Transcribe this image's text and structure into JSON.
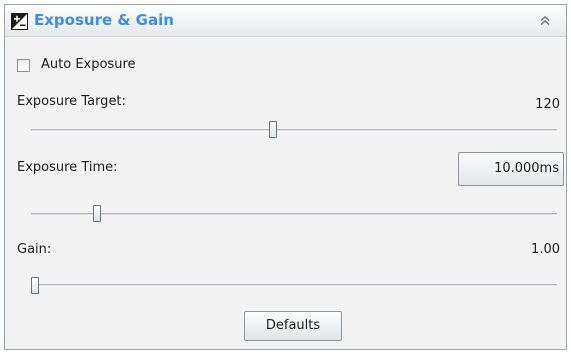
{
  "panel": {
    "title": "Exposure & Gain",
    "title_icon": "exposure-icon",
    "collapse_icon": "double-chevron-up-icon",
    "accent_color": "#3d8ee6"
  },
  "auto_exposure": {
    "label": "Auto Exposure",
    "checked": false
  },
  "exposure_target": {
    "label": "Exposure Target:",
    "value": "120",
    "slider_fraction": 0.46
  },
  "exposure_time": {
    "label": "Exposure Time:",
    "value": "10.000ms",
    "slider_fraction": 0.12
  },
  "gain": {
    "label": "Gain:",
    "value": "1.00",
    "slider_fraction": 0.0
  },
  "defaults_button": {
    "label": "Defaults"
  }
}
